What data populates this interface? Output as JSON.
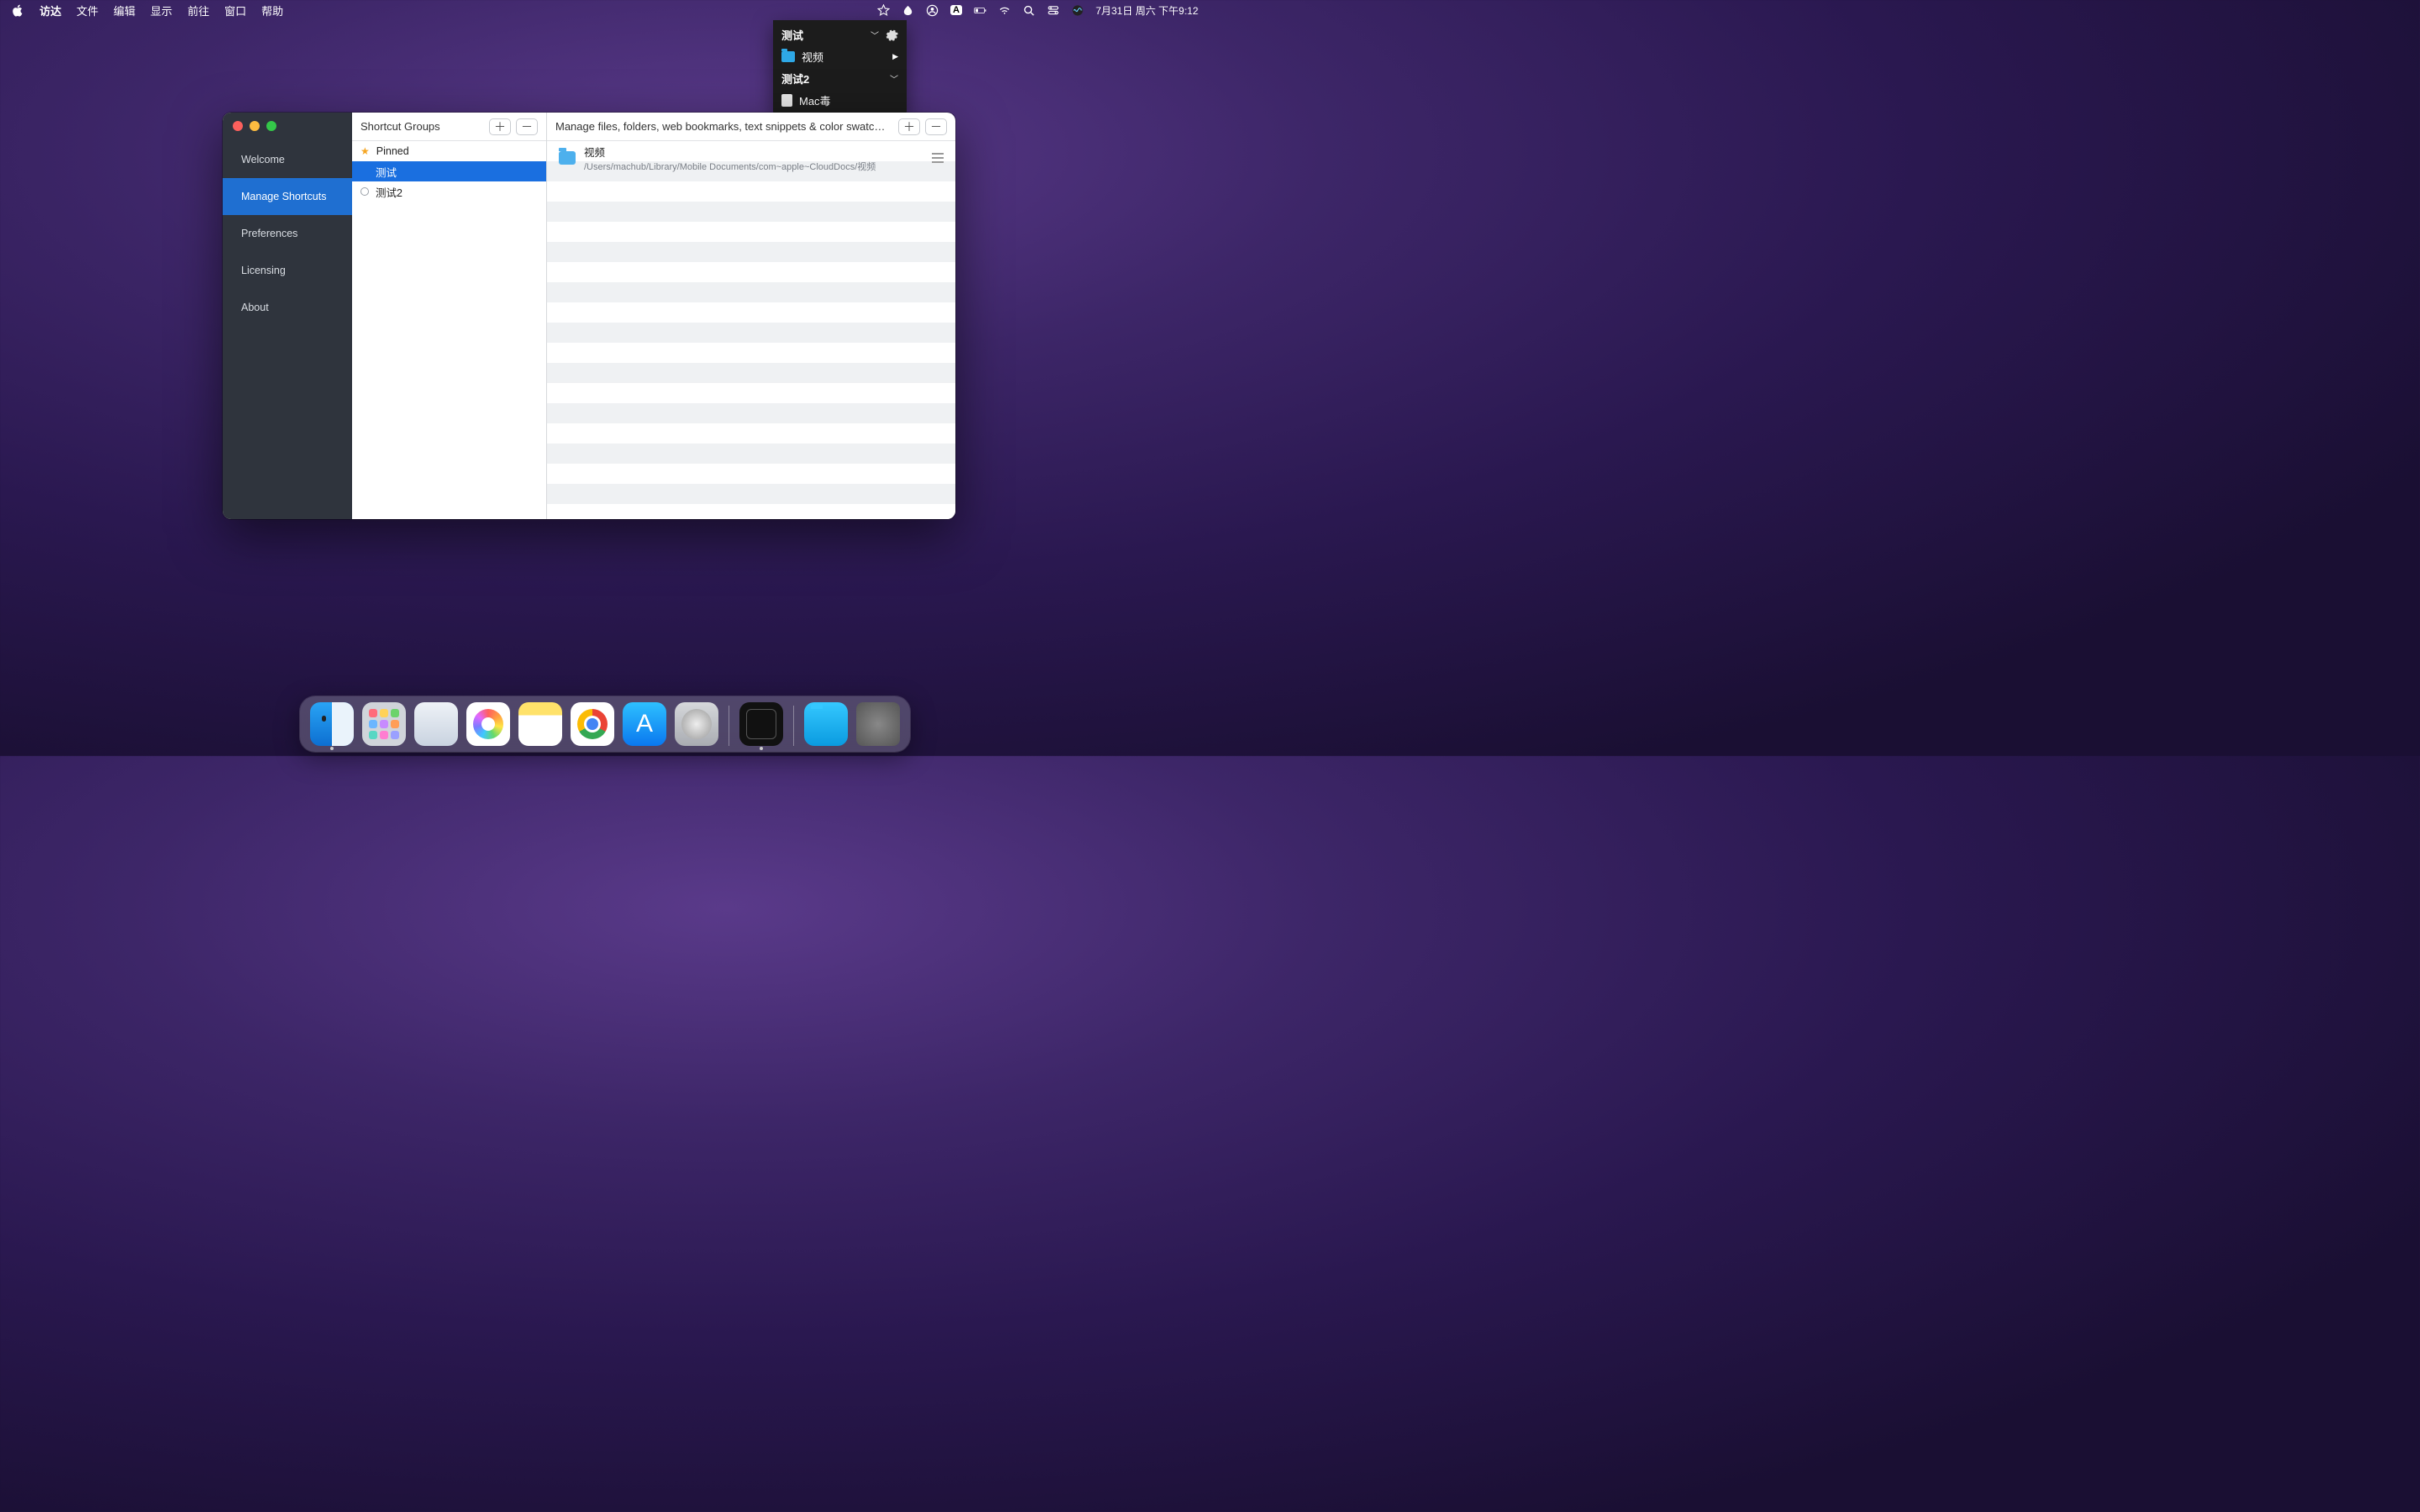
{
  "menubar": {
    "app": "访达",
    "items": [
      "文件",
      "编辑",
      "显示",
      "前往",
      "窗口",
      "帮助"
    ],
    "input_badge": "A",
    "clock": "7月31日 周六 下午9:12"
  },
  "dropdown": {
    "group1": "测试",
    "item_folder": "视频",
    "group2": "测试2",
    "item_doc": "Mac毒"
  },
  "window": {
    "sidebar": {
      "items": [
        "Welcome",
        "Manage Shortcuts",
        "Preferences",
        "Licensing",
        "About"
      ],
      "selected_index": 1
    },
    "groups_panel": {
      "title": "Shortcut Groups",
      "rows": [
        {
          "label": "Pinned",
          "kind": "star"
        },
        {
          "label": "测试",
          "kind": "plain",
          "selected": true
        },
        {
          "label": "测试2",
          "kind": "open"
        }
      ]
    },
    "main_panel": {
      "title": "Manage files, folders, web bookmarks, text snippets & color swatc…",
      "entry": {
        "name": "视频",
        "path": "/Users/machub/Library/Mobile Documents/com~apple~CloudDocs/视频"
      }
    }
  },
  "dock": {
    "apps": [
      "finder",
      "launchpad",
      "safari",
      "photos",
      "notes",
      "chrome",
      "appstore",
      "settings"
    ],
    "recent": [
      "monitor"
    ],
    "right": [
      "folder",
      "trash"
    ]
  }
}
